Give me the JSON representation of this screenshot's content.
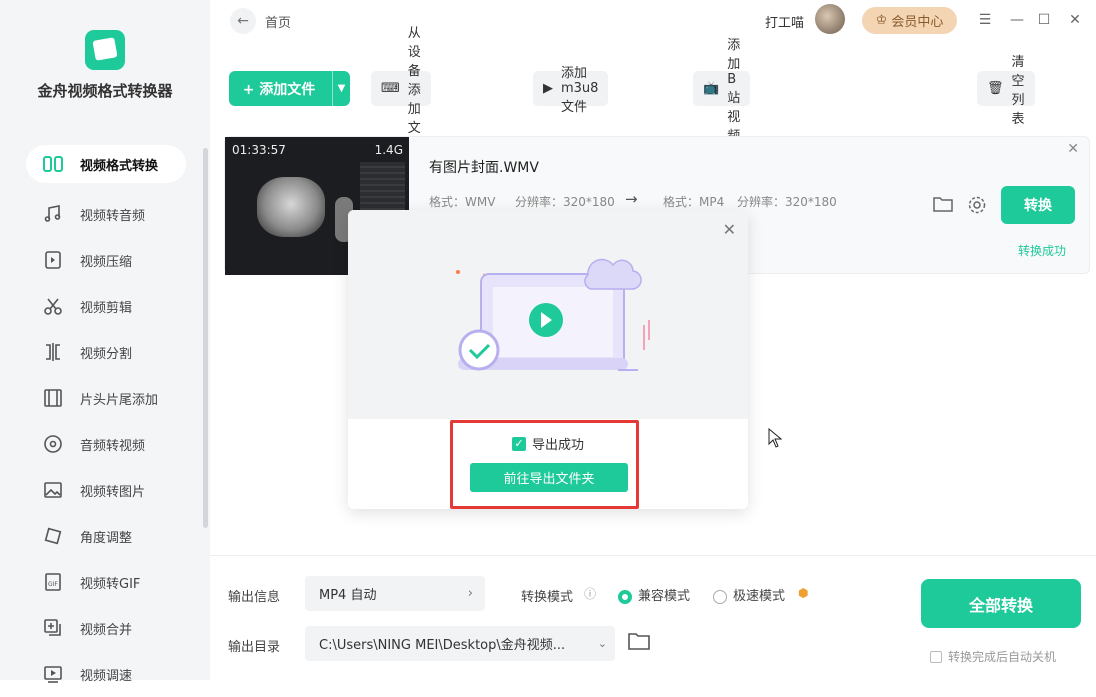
{
  "app": {
    "title": "金舟视频格式转换器"
  },
  "sidebar": {
    "items": [
      {
        "label": "视频格式转换",
        "icon": "convert-icon",
        "active": true
      },
      {
        "label": "视频转音频",
        "icon": "music-icon"
      },
      {
        "label": "视频压缩",
        "icon": "compress-icon"
      },
      {
        "label": "视频剪辑",
        "icon": "scissors-icon"
      },
      {
        "label": "视频分割",
        "icon": "split-icon"
      },
      {
        "label": "片头片尾添加",
        "icon": "film-icon"
      },
      {
        "label": "音频转视频",
        "icon": "disc-icon"
      },
      {
        "label": "视频转图片",
        "icon": "image-icon"
      },
      {
        "label": "角度调整",
        "icon": "rotate-icon"
      },
      {
        "label": "视频转GIF",
        "icon": "gif-icon"
      },
      {
        "label": "视频合并",
        "icon": "merge-icon"
      },
      {
        "label": "视频调速",
        "icon": "speed-icon"
      }
    ]
  },
  "topbar": {
    "breadcrumb": "首页",
    "username": "打工喵",
    "vip_label": "会员中心"
  },
  "toolbar": {
    "add_file": "+ 添加文件",
    "from_device": "从设备添加文件",
    "add_m3u8": "添加m3u8文件",
    "add_bilibili": "添加B站视频",
    "clear_list": "清空列表"
  },
  "file": {
    "duration": "01:33:57",
    "size": "1.4G",
    "name": "有图片封面.WMV",
    "src_format": "格式：WMV",
    "src_resolution": "分辨率：320*180",
    "dst_format": "格式：MP4",
    "dst_resolution": "分辨率：320*180",
    "convert_label": "转换",
    "status": "转换成功"
  },
  "modal": {
    "success_text": "导出成功",
    "goto_label": "前往导出文件夹"
  },
  "bottom": {
    "output_info_label": "输出信息",
    "output_format": "MP4 自动",
    "mode_label": "转换模式",
    "mode_compat": "兼容模式",
    "mode_fast": "极速模式",
    "output_dir_label": "输出目录",
    "output_dir": "C:\\Users\\NING MEI\\Desktop\\金舟视频...",
    "convert_all": "全部转换",
    "auto_shutdown": "转换完成后自动关机"
  },
  "colors": {
    "accent": "#1ec99a",
    "highlight": "#e53935",
    "vip": "#f3d4b3"
  }
}
